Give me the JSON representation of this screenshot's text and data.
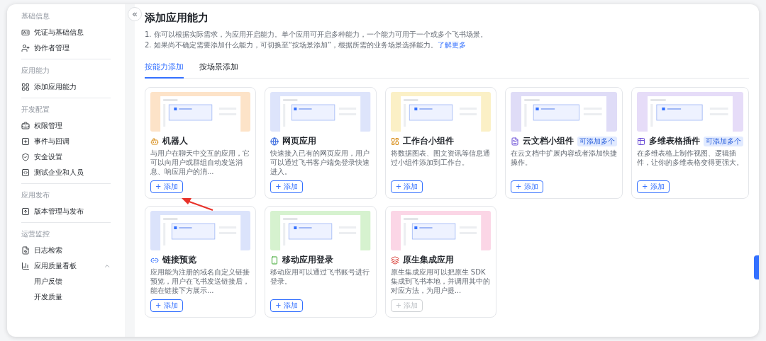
{
  "sidebar": {
    "collapse_button": "«",
    "sections": [
      {
        "title": "基础信息",
        "items": [
          {
            "label": "凭证与基础信息"
          },
          {
            "label": "协作者管理"
          }
        ]
      },
      {
        "title": "应用能力",
        "items": [
          {
            "label": "添加应用能力"
          }
        ]
      },
      {
        "title": "开发配置",
        "items": [
          {
            "label": "权限管理"
          },
          {
            "label": "事件与回调"
          },
          {
            "label": "安全设置"
          },
          {
            "label": "测试企业和人员"
          }
        ]
      },
      {
        "title": "应用发布",
        "items": [
          {
            "label": "版本管理与发布"
          }
        ]
      },
      {
        "title": "运营监控",
        "items": [
          {
            "label": "日志检索"
          },
          {
            "label": "应用质量看板",
            "expanded": true,
            "children": [
              {
                "label": "用户反馈"
              },
              {
                "label": "开发质量"
              }
            ]
          }
        ]
      }
    ]
  },
  "main": {
    "title": "添加应用能力",
    "notes": [
      "1. 你可以根据实际需求，为应用开启能力。单个应用可开启多种能力，一个能力可用于一个或多个飞书场景。",
      "2. 如果尚不确定需要添加什么能力，可切换至“按场景添加”，根据所需的业务场景选择能力。"
    ],
    "learn_more_link": "了解更多",
    "tabs": [
      {
        "label": "按能力添加",
        "selected": true
      },
      {
        "label": "按场景添加",
        "selected": false
      }
    ],
    "cards": [
      {
        "title": "机器人",
        "color": "#fde3c8",
        "description": "与用户在聊天中交互的应用，它可以向用户或群组自动发送消息、响应用户的消...",
        "add_button": {
          "label": "+ 添加",
          "disabled": false
        }
      },
      {
        "title": "网页应用",
        "color": "#dde4fb",
        "description": "快速接入已有的网页应用，用户可以通过飞书客户端免登录快速进入。",
        "add_button": {
          "label": "+ 添加",
          "disabled": false
        }
      },
      {
        "title": "工作台小组件",
        "color": "#fbf0c6",
        "description": "将数据图表、图文资讯等信息通过小组件添加到工作台。",
        "add_button": {
          "label": "+ 添加",
          "disabled": false
        }
      },
      {
        "title": "云文档小组件",
        "badge": "可添加多个",
        "color": "#dfdcf7",
        "description": "在云文档中扩展内容或者添加快捷操作。",
        "add_button": {
          "label": "+ 添加",
          "disabled": false
        }
      },
      {
        "title": "多维表格插件",
        "badge": "可添加多个",
        "color": "#e6dcf8",
        "description": "在多维表格上制作视图、逻辑插件，让你的多维表格变得更强大。",
        "add_button": {
          "label": "+ 添加",
          "disabled": false
        }
      },
      {
        "title": "链接预览",
        "color": "#dbe3fb",
        "description": "应用能为注册的域名自定义链接预览，用户在飞书发送链接后，能在链接下方展示...",
        "add_button": {
          "label": "+ 添加",
          "disabled": false
        }
      },
      {
        "title": "移动应用登录",
        "color": "#d6f2cf",
        "description": "移动应用可以通过飞书账号进行登录。",
        "add_button": {
          "label": "+ 添加",
          "disabled": false
        }
      },
      {
        "title": "原生集成应用",
        "color": "#fbd6e6",
        "description": "原生集成应用可以把原生 SDK 集成到飞书本地，并调用其中的对应方法，为用户提...",
        "add_button": {
          "label": "+ 添加",
          "disabled": true
        }
      }
    ]
  }
}
